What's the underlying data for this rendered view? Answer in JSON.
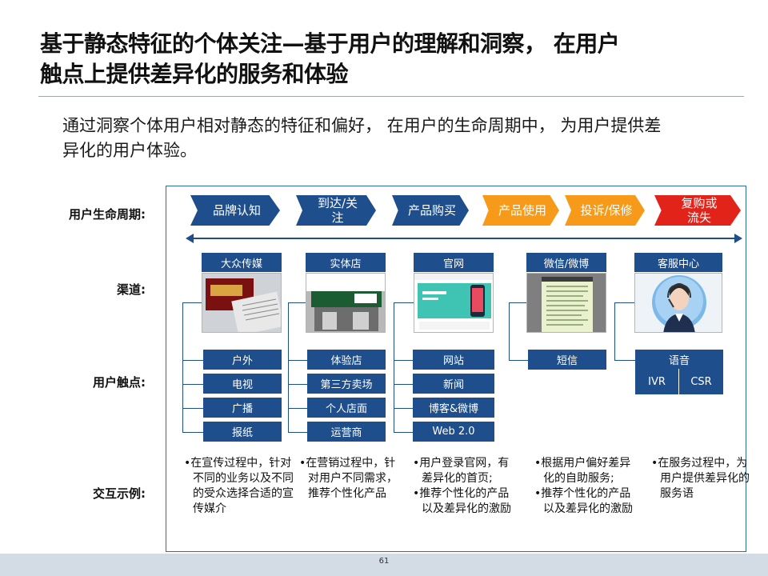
{
  "title": {
    "line1": "基于静态特征的个体关注—基于用户的理解和洞察， 在用户",
    "line2": "触点上提供差异化的服务和体验"
  },
  "subtitle": {
    "line1": "通过洞察个体用户相对静态的特征和偏好， 在用户的生命周期中， 为用户提供差",
    "line2": "异化的用户体验。"
  },
  "row_labels": {
    "lifecycle": "用户生命周期:",
    "channels": "渠道:",
    "touchpoints": "用户触点:",
    "examples": "交互示例:"
  },
  "stages": [
    {
      "label": "品牌认知"
    },
    {
      "label": "到达/关注"
    },
    {
      "label": "产品购买"
    },
    {
      "label": "产品使用"
    },
    {
      "label": "投诉/保修"
    },
    {
      "label": "复购或流失"
    }
  ],
  "channels": [
    {
      "label": "大众传媒"
    },
    {
      "label": "实体店"
    },
    {
      "label": "官网"
    },
    {
      "label": "微信/微博"
    },
    {
      "label": "客服中心"
    }
  ],
  "touchpoints": {
    "media": [
      "户外",
      "电视",
      "广播",
      "报纸"
    ],
    "store": [
      "体验店",
      "第三方卖场",
      "个人店面",
      "运营商"
    ],
    "web": [
      "网站",
      "新闻",
      "博客&微博",
      "Web 2.0"
    ],
    "wechat": [
      "短信"
    ],
    "service": {
      "title": "语音",
      "items": [
        "IVR",
        "CSR"
      ]
    }
  },
  "examples": [
    [
      "•在宣传过程中，针对不同的业务以及不同的受众选择合适的宣传媒介"
    ],
    [
      "•在营销过程中，针对用户不同需求，推荐个性化产品"
    ],
    [
      "•用户登录官网，有差异化的首页;",
      "•推荐个性化的产品以及差异化的激励"
    ],
    [
      "•根据用户偏好差异化的自助服务;",
      "•推荐个性化的产品以及差异化的激励"
    ],
    [
      "•在服务过程中，为用户提供差异化的服务语"
    ]
  ],
  "page_number": "61",
  "colors": {
    "blue": "#1f4e8c",
    "orange": "#f79a1a",
    "red": "#e2231a"
  }
}
